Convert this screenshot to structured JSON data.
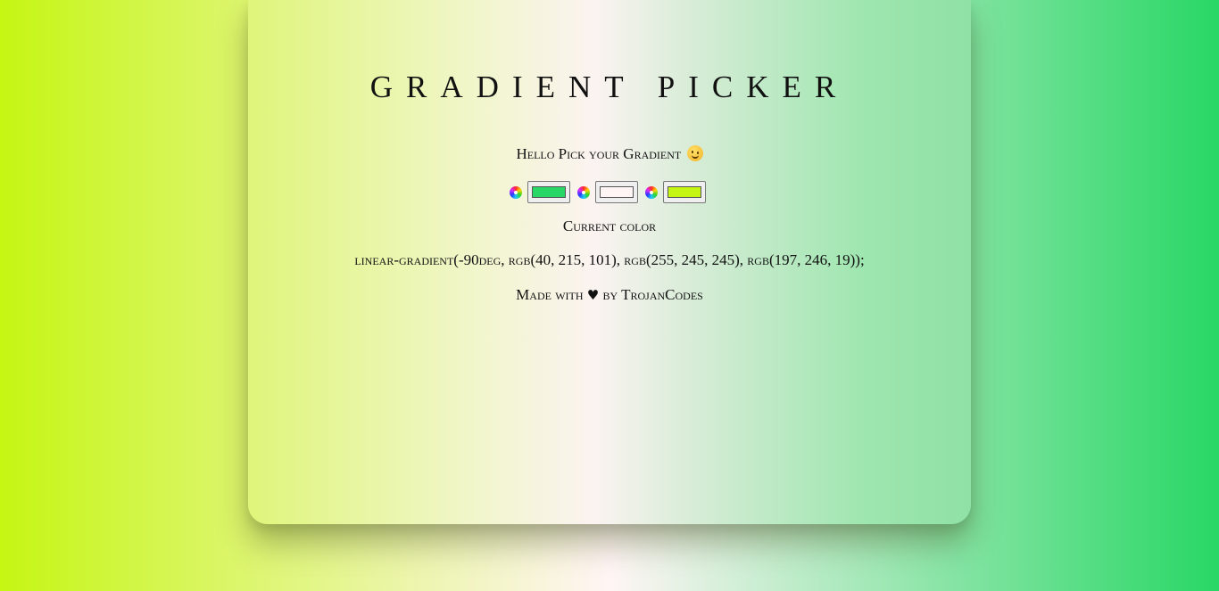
{
  "title": "Gradient Picker",
  "greeting": "Hello Pick your Gradient",
  "greeting_emoji": "winking-face",
  "pickers": [
    {
      "color": "#28d765"
    },
    {
      "color": "#fff5f5"
    },
    {
      "color": "#c5f613"
    }
  ],
  "current_label": "Current color",
  "gradient_code": "linear-gradient(-90deg, rgb(40, 215, 101), rgb(255, 245, 245), rgb(197, 246, 19));",
  "footer": {
    "prefix": "Made with",
    "heart": "♥",
    "suffix": "by TrojanCodes"
  }
}
